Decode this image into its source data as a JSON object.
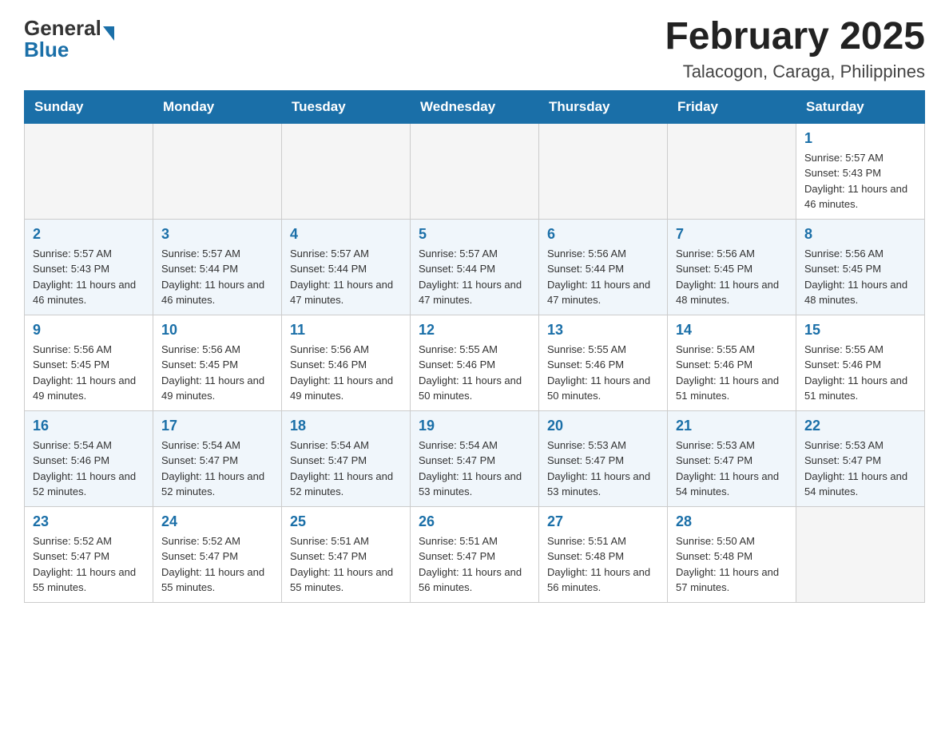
{
  "logo": {
    "text_general": "General",
    "arrow_color": "#1a6fa8",
    "text_blue": "Blue"
  },
  "title": "February 2025",
  "subtitle": "Talacogon, Caraga, Philippines",
  "days_of_week": [
    "Sunday",
    "Monday",
    "Tuesday",
    "Wednesday",
    "Thursday",
    "Friday",
    "Saturday"
  ],
  "weeks": [
    [
      {
        "day": "",
        "info": ""
      },
      {
        "day": "",
        "info": ""
      },
      {
        "day": "",
        "info": ""
      },
      {
        "day": "",
        "info": ""
      },
      {
        "day": "",
        "info": ""
      },
      {
        "day": "",
        "info": ""
      },
      {
        "day": "1",
        "info": "Sunrise: 5:57 AM\nSunset: 5:43 PM\nDaylight: 11 hours and 46 minutes."
      }
    ],
    [
      {
        "day": "2",
        "info": "Sunrise: 5:57 AM\nSunset: 5:43 PM\nDaylight: 11 hours and 46 minutes."
      },
      {
        "day": "3",
        "info": "Sunrise: 5:57 AM\nSunset: 5:44 PM\nDaylight: 11 hours and 46 minutes."
      },
      {
        "day": "4",
        "info": "Sunrise: 5:57 AM\nSunset: 5:44 PM\nDaylight: 11 hours and 47 minutes."
      },
      {
        "day": "5",
        "info": "Sunrise: 5:57 AM\nSunset: 5:44 PM\nDaylight: 11 hours and 47 minutes."
      },
      {
        "day": "6",
        "info": "Sunrise: 5:56 AM\nSunset: 5:44 PM\nDaylight: 11 hours and 47 minutes."
      },
      {
        "day": "7",
        "info": "Sunrise: 5:56 AM\nSunset: 5:45 PM\nDaylight: 11 hours and 48 minutes."
      },
      {
        "day": "8",
        "info": "Sunrise: 5:56 AM\nSunset: 5:45 PM\nDaylight: 11 hours and 48 minutes."
      }
    ],
    [
      {
        "day": "9",
        "info": "Sunrise: 5:56 AM\nSunset: 5:45 PM\nDaylight: 11 hours and 49 minutes."
      },
      {
        "day": "10",
        "info": "Sunrise: 5:56 AM\nSunset: 5:45 PM\nDaylight: 11 hours and 49 minutes."
      },
      {
        "day": "11",
        "info": "Sunrise: 5:56 AM\nSunset: 5:46 PM\nDaylight: 11 hours and 49 minutes."
      },
      {
        "day": "12",
        "info": "Sunrise: 5:55 AM\nSunset: 5:46 PM\nDaylight: 11 hours and 50 minutes."
      },
      {
        "day": "13",
        "info": "Sunrise: 5:55 AM\nSunset: 5:46 PM\nDaylight: 11 hours and 50 minutes."
      },
      {
        "day": "14",
        "info": "Sunrise: 5:55 AM\nSunset: 5:46 PM\nDaylight: 11 hours and 51 minutes."
      },
      {
        "day": "15",
        "info": "Sunrise: 5:55 AM\nSunset: 5:46 PM\nDaylight: 11 hours and 51 minutes."
      }
    ],
    [
      {
        "day": "16",
        "info": "Sunrise: 5:54 AM\nSunset: 5:46 PM\nDaylight: 11 hours and 52 minutes."
      },
      {
        "day": "17",
        "info": "Sunrise: 5:54 AM\nSunset: 5:47 PM\nDaylight: 11 hours and 52 minutes."
      },
      {
        "day": "18",
        "info": "Sunrise: 5:54 AM\nSunset: 5:47 PM\nDaylight: 11 hours and 52 minutes."
      },
      {
        "day": "19",
        "info": "Sunrise: 5:54 AM\nSunset: 5:47 PM\nDaylight: 11 hours and 53 minutes."
      },
      {
        "day": "20",
        "info": "Sunrise: 5:53 AM\nSunset: 5:47 PM\nDaylight: 11 hours and 53 minutes."
      },
      {
        "day": "21",
        "info": "Sunrise: 5:53 AM\nSunset: 5:47 PM\nDaylight: 11 hours and 54 minutes."
      },
      {
        "day": "22",
        "info": "Sunrise: 5:53 AM\nSunset: 5:47 PM\nDaylight: 11 hours and 54 minutes."
      }
    ],
    [
      {
        "day": "23",
        "info": "Sunrise: 5:52 AM\nSunset: 5:47 PM\nDaylight: 11 hours and 55 minutes."
      },
      {
        "day": "24",
        "info": "Sunrise: 5:52 AM\nSunset: 5:47 PM\nDaylight: 11 hours and 55 minutes."
      },
      {
        "day": "25",
        "info": "Sunrise: 5:51 AM\nSunset: 5:47 PM\nDaylight: 11 hours and 55 minutes."
      },
      {
        "day": "26",
        "info": "Sunrise: 5:51 AM\nSunset: 5:47 PM\nDaylight: 11 hours and 56 minutes."
      },
      {
        "day": "27",
        "info": "Sunrise: 5:51 AM\nSunset: 5:48 PM\nDaylight: 11 hours and 56 minutes."
      },
      {
        "day": "28",
        "info": "Sunrise: 5:50 AM\nSunset: 5:48 PM\nDaylight: 11 hours and 57 minutes."
      },
      {
        "day": "",
        "info": ""
      }
    ]
  ]
}
